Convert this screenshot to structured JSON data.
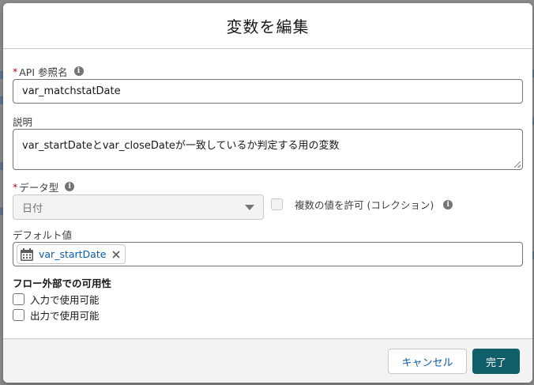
{
  "modal": {
    "title": "変数を編集"
  },
  "api_name": {
    "label": "API 参照名",
    "value": "var_matchstatDate"
  },
  "description": {
    "label": "説明",
    "value": "var_startDateとvar_closeDateが一致しているか判定する用の変数"
  },
  "data_type": {
    "label": "データ型",
    "selected": "日付"
  },
  "collection": {
    "label": "複数の値を許可 (コレクション)",
    "checked": false
  },
  "default_value": {
    "label": "デフォルト値",
    "pill_label": "var_startDate"
  },
  "availability": {
    "title": "フロー外部での可用性",
    "input_label": "入力で使用可能",
    "output_label": "出力で使用可能"
  },
  "footer": {
    "cancel_label": "キャンセル",
    "done_label": "完了"
  },
  "colors": {
    "brand": "#0f5f6b",
    "link": "#0b5cab",
    "required": "#ba0517"
  },
  "icons": {
    "info": "info-icon",
    "calendar": "calendar-icon",
    "close": "close-icon",
    "caret": "chevron-down-icon"
  }
}
